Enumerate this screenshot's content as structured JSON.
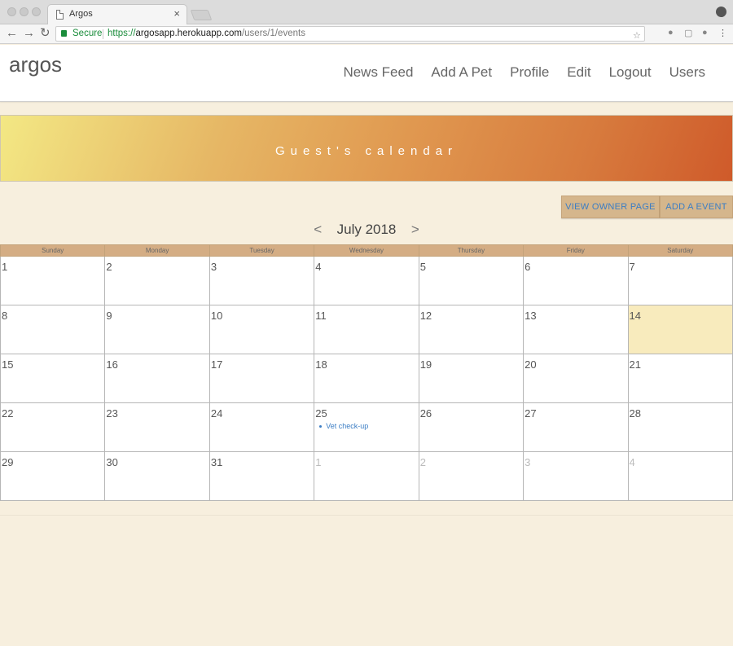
{
  "browser": {
    "tab_title": "Argos",
    "close_glyph": "×",
    "secure_label": "Secure",
    "url_scheme": "https://",
    "url_host": "argosapp.herokuapp.com",
    "url_path": "/users/1/events"
  },
  "site": {
    "brand": "argos",
    "nav": [
      "News Feed",
      "Add A Pet",
      "Profile",
      "Edit",
      "Logout",
      "Users"
    ]
  },
  "banner": {
    "title": "Guest's calendar"
  },
  "actions": {
    "view_owner": "VIEW OWNER PAGE",
    "add_event": "ADD A EVENT"
  },
  "month_nav": {
    "prev": "<",
    "label": "July 2018",
    "next": ">"
  },
  "calendar": {
    "weekdays": [
      "Sunday",
      "Monday",
      "Tuesday",
      "Wednesday",
      "Thursday",
      "Friday",
      "Saturday"
    ],
    "weeks": [
      [
        {
          "day": "1"
        },
        {
          "day": "2"
        },
        {
          "day": "3"
        },
        {
          "day": "4"
        },
        {
          "day": "5"
        },
        {
          "day": "6"
        },
        {
          "day": "7"
        }
      ],
      [
        {
          "day": "8"
        },
        {
          "day": "9"
        },
        {
          "day": "10"
        },
        {
          "day": "11"
        },
        {
          "day": "12"
        },
        {
          "day": "13"
        },
        {
          "day": "14",
          "today": true
        }
      ],
      [
        {
          "day": "15"
        },
        {
          "day": "16"
        },
        {
          "day": "17"
        },
        {
          "day": "18"
        },
        {
          "day": "19"
        },
        {
          "day": "20"
        },
        {
          "day": "21"
        }
      ],
      [
        {
          "day": "22"
        },
        {
          "day": "23"
        },
        {
          "day": "24"
        },
        {
          "day": "25",
          "event": "Vet check-up"
        },
        {
          "day": "26"
        },
        {
          "day": "27"
        },
        {
          "day": "28"
        }
      ],
      [
        {
          "day": "29"
        },
        {
          "day": "30"
        },
        {
          "day": "31"
        },
        {
          "day": "1",
          "other": true
        },
        {
          "day": "2",
          "other": true
        },
        {
          "day": "3",
          "other": true
        },
        {
          "day": "4",
          "other": true
        }
      ]
    ]
  },
  "colors": {
    "background": "#f7efde",
    "header_row": "#d4ad84",
    "button": "#d5b68c",
    "link": "#3b7dc4",
    "today": "#f8ebbd"
  }
}
